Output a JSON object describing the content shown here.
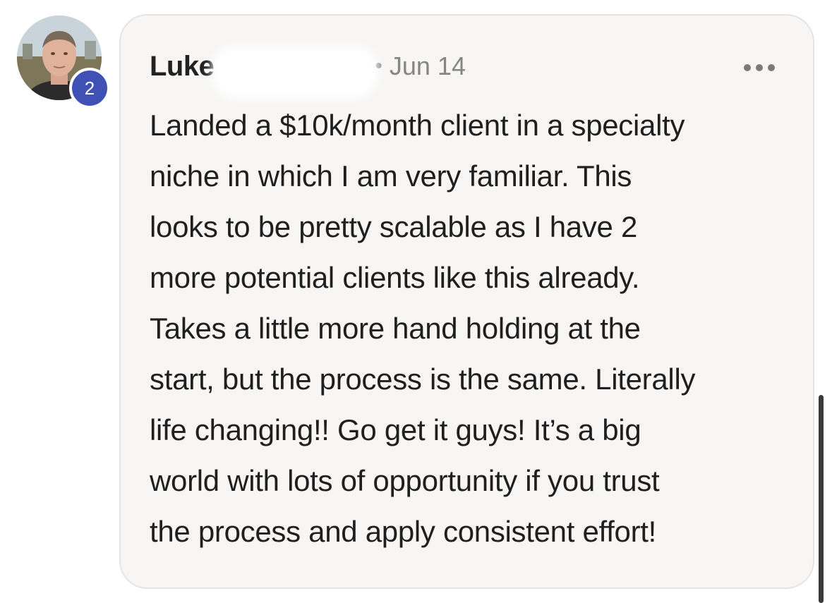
{
  "comment": {
    "author": "Luke",
    "level_badge": "2",
    "separator": "•",
    "date": "Jun 14",
    "more_icon": "ellipsis-icon",
    "body_lines": [
      "Landed a $10k/month client in a specialty",
      "niche in which I am very familiar. This",
      "looks to be pretty scalable as I have 2",
      "more potential clients like this already.",
      "Takes a little more hand holding at the",
      "start, but the process is the same. Literally",
      "life changing!! Go get it guys! It’s a big",
      "world with lots of opportunity if you trust",
      "the process and apply consistent effort!"
    ]
  },
  "colors": {
    "bubble_background": "#f7f6f5",
    "badge": "#3f51b5",
    "text": "#1f1f1f",
    "meta": "#858585"
  }
}
